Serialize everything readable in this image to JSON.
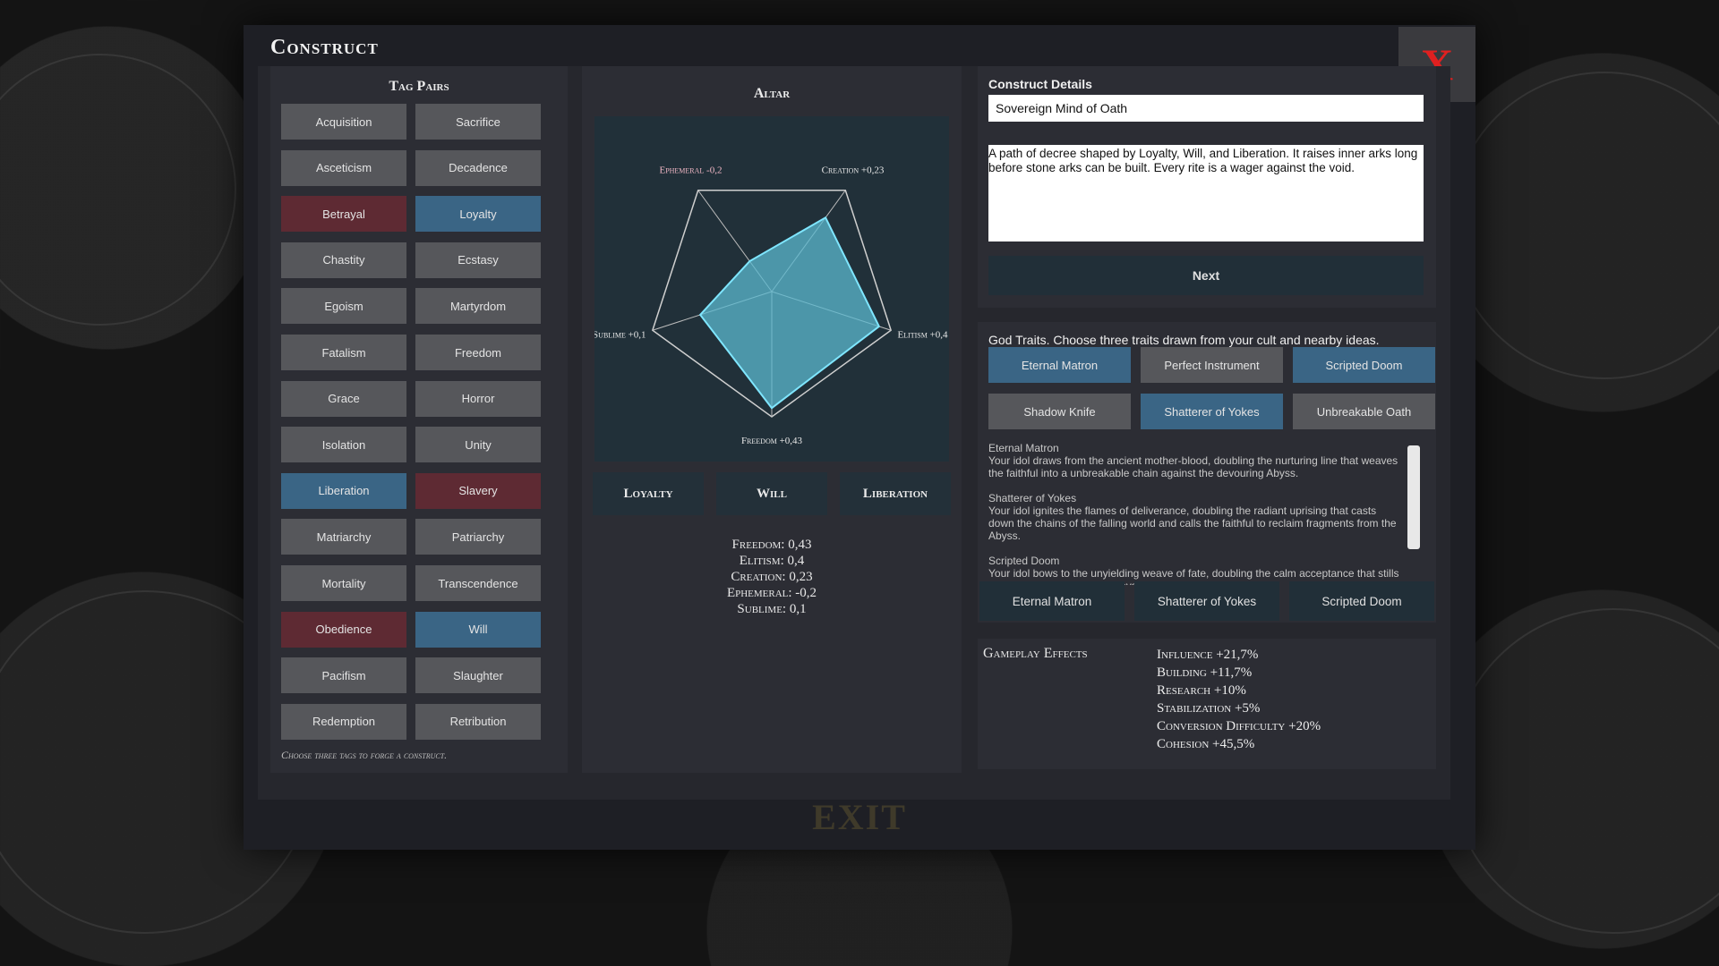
{
  "window": {
    "title": "Construct",
    "close_label": "X",
    "exit_label": "EXIT"
  },
  "tag_pairs": {
    "title": "Tag Pairs",
    "hint": "Choose three tags to forge a construct.",
    "rows": [
      [
        {
          "label": "Acquisition",
          "state": "none"
        },
        {
          "label": "Sacrifice",
          "state": "none"
        }
      ],
      [
        {
          "label": "Asceticism",
          "state": "none"
        },
        {
          "label": "Decadence",
          "state": "none"
        }
      ],
      [
        {
          "label": "Betrayal",
          "state": "red"
        },
        {
          "label": "Loyalty",
          "state": "blue"
        }
      ],
      [
        {
          "label": "Chastity",
          "state": "none"
        },
        {
          "label": "Ecstasy",
          "state": "none"
        }
      ],
      [
        {
          "label": "Egoism",
          "state": "none"
        },
        {
          "label": "Martyrdom",
          "state": "none"
        }
      ],
      [
        {
          "label": "Fatalism",
          "state": "none"
        },
        {
          "label": "Freedom",
          "state": "none"
        }
      ],
      [
        {
          "label": "Grace",
          "state": "none"
        },
        {
          "label": "Horror",
          "state": "none"
        }
      ],
      [
        {
          "label": "Isolation",
          "state": "none"
        },
        {
          "label": "Unity",
          "state": "none"
        }
      ],
      [
        {
          "label": "Liberation",
          "state": "blue"
        },
        {
          "label": "Slavery",
          "state": "red"
        }
      ],
      [
        {
          "label": "Matriarchy",
          "state": "none"
        },
        {
          "label": "Patriarchy",
          "state": "none"
        }
      ],
      [
        {
          "label": "Mortality",
          "state": "none"
        },
        {
          "label": "Transcendence",
          "state": "none"
        }
      ],
      [
        {
          "label": "Obedience",
          "state": "red"
        },
        {
          "label": "Will",
          "state": "blue"
        }
      ],
      [
        {
          "label": "Pacifism",
          "state": "none"
        },
        {
          "label": "Slaughter",
          "state": "none"
        }
      ],
      [
        {
          "label": "Redemption",
          "state": "none"
        },
        {
          "label": "Retribution",
          "state": "none"
        }
      ]
    ]
  },
  "altar": {
    "title": "Altar",
    "radar_labels": [
      {
        "key": "creation",
        "label": "Creation +0,23",
        "color": "#e8e8e8"
      },
      {
        "key": "elitism",
        "label": "Elitism +0,4",
        "color": "#e8e8e8"
      },
      {
        "key": "freedom",
        "label": "Freedom +0,43",
        "color": "#e8e8e8"
      },
      {
        "key": "sublime",
        "label": "Sublime +0,1",
        "color": "#e8e8e8"
      },
      {
        "key": "ephemeral",
        "label": "Ephemeral -0,2",
        "color": "#f2b8c6"
      }
    ],
    "buttons": [
      "Loyalty",
      "Will",
      "Liberation"
    ],
    "stats": [
      "Freedom: 0,43",
      "Elitism: 0,4",
      "Creation: 0,23",
      "Ephemeral: -0,2",
      "Sublime: 0,1"
    ]
  },
  "chart_data": {
    "type": "radar",
    "axes": [
      "Creation",
      "Elitism",
      "Freedom",
      "Sublime",
      "Ephemeral"
    ],
    "values": [
      0.23,
      0.4,
      0.43,
      0.1,
      -0.2
    ],
    "range": [
      -0.5,
      0.5
    ],
    "fill_color": "#5bb8cf"
  },
  "details": {
    "label": "Construct Details",
    "name_value": "Sovereign Mind of Oath",
    "description": "A path of decree shaped by Loyalty, Will, and Liberation. It raises inner arks long before stone arks can be built. Every rite is a wager against the void.",
    "next_label": "Next"
  },
  "god_traits": {
    "header": "God Traits. Choose three traits drawn from your cult and nearby ideas.",
    "traits": [
      {
        "label": "Eternal Matron",
        "selected": true
      },
      {
        "label": "Perfect Instrument",
        "selected": false
      },
      {
        "label": "Scripted Doom",
        "selected": true
      },
      {
        "label": "Shadow Knife",
        "selected": false
      },
      {
        "label": "Shatterer of Yokes",
        "selected": true
      },
      {
        "label": "Unbreakable Oath",
        "selected": false
      }
    ],
    "descriptions": [
      {
        "title": "Eternal Matron",
        "body": "Your idol draws from the ancient mother-blood, doubling the nurturing line that weaves the faithful into a unbreakable chain against the devouring Abyss."
      },
      {
        "title": "Shatterer of Yokes",
        "body": "Your idol ignites the flames of deliverance, doubling the radiant uprising that casts down the chains of the falling world and calls the faithful to reclaim fragments from the Abyss."
      },
      {
        "title": "Scripted Doom",
        "body": "Your idol bows to the unyielding weave of fate, doubling the calm acceptance that stills the faithful's hearts as the Abyss claims its written toll."
      }
    ],
    "chosen": [
      "Eternal Matron",
      "Shatterer of Yokes",
      "Scripted Doom"
    ]
  },
  "effects": {
    "label": "Gameplay Effects",
    "items": [
      "Influence +21,7%",
      "Building +11,7%",
      "Research +10%",
      "Stabilization +5%",
      "Conversion Difficulty +20%",
      "Cohesion +45,5%"
    ]
  }
}
